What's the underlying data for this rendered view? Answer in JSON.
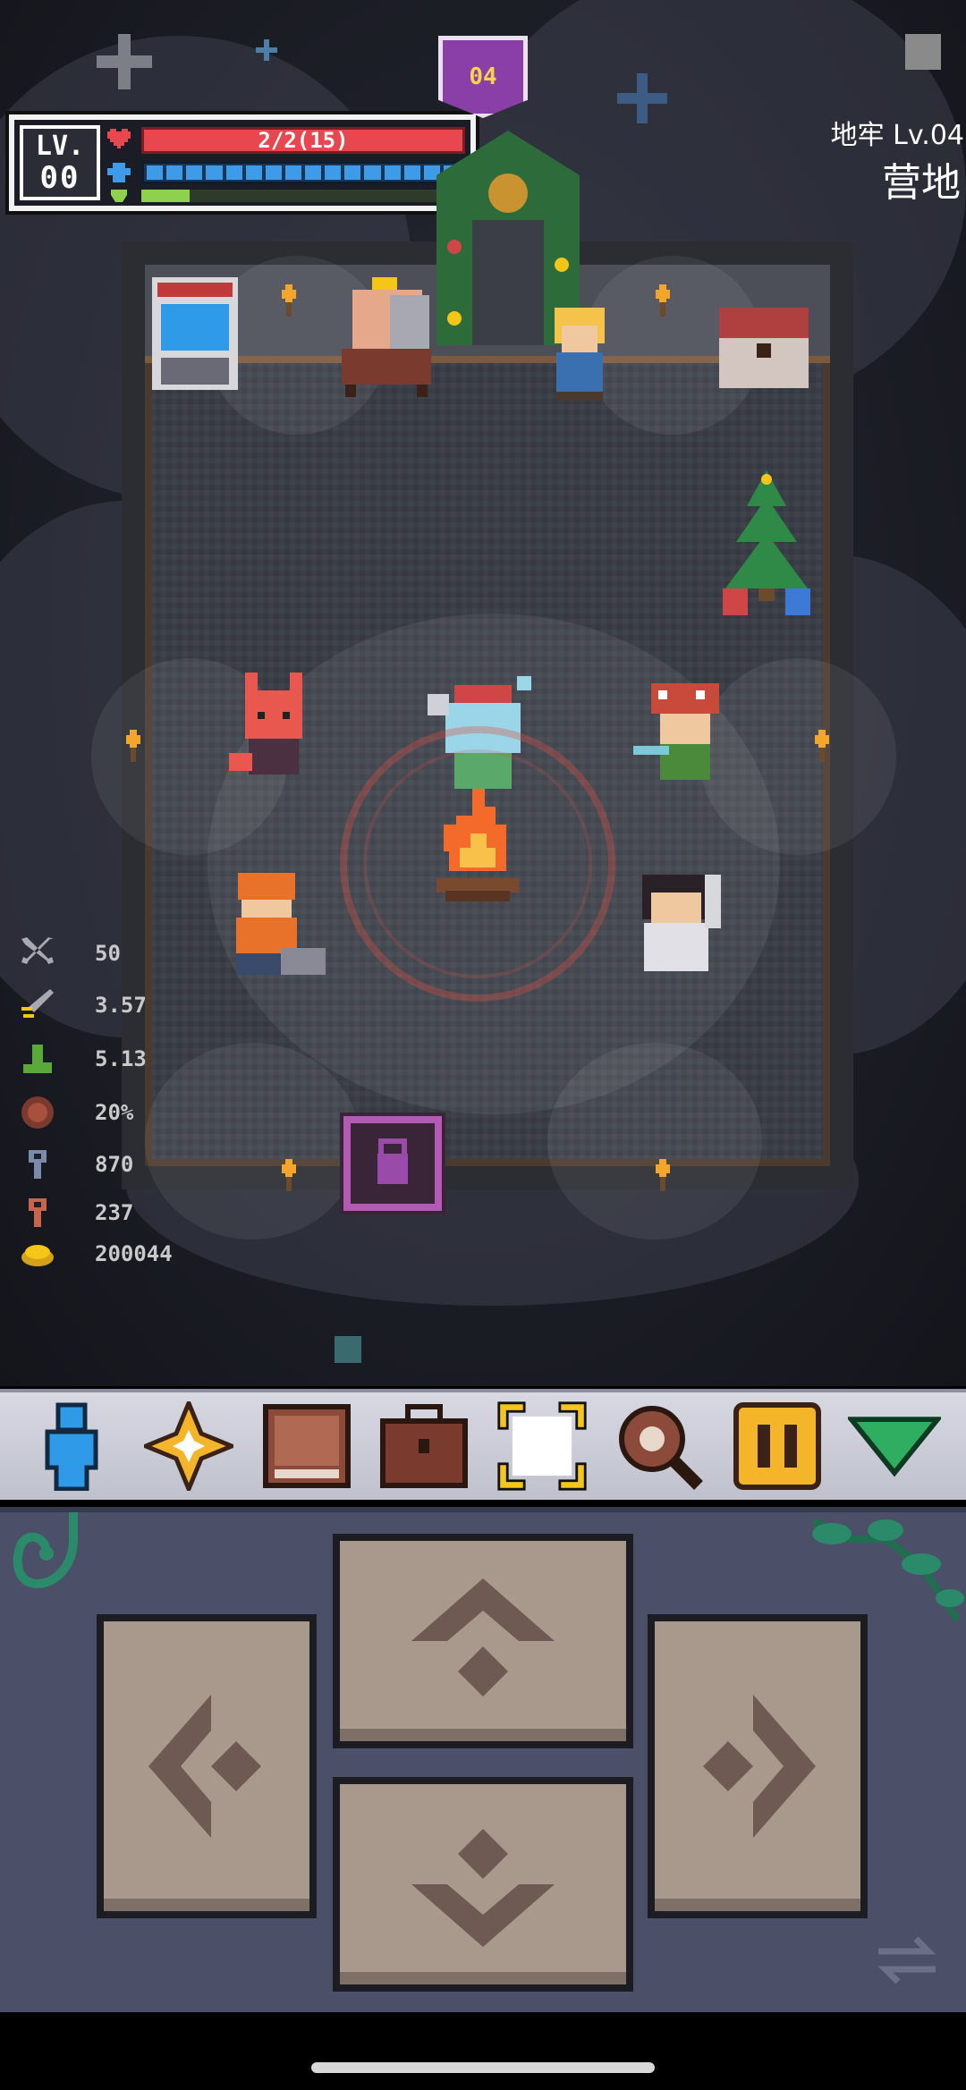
{
  "hud": {
    "level_label": "LV.",
    "level_value": "00",
    "hp_text": "2/2(15)",
    "mp_segments": 16,
    "xp_fraction": 0.15,
    "floor_badge": "04"
  },
  "location": {
    "dungeon": "地牢 Lv.04",
    "area": "营地"
  },
  "stats": [
    {
      "icon": "crossed-swords-icon",
      "value": "50"
    },
    {
      "icon": "sword-speed-icon",
      "value": "3.57"
    },
    {
      "icon": "boot-icon",
      "value": "5.13"
    },
    {
      "icon": "shield-icon",
      "value": "20%"
    },
    {
      "icon": "blue-key-icon",
      "value": "870"
    },
    {
      "icon": "red-key-icon",
      "value": "237"
    },
    {
      "icon": "gold-coin-icon",
      "value": "200044"
    }
  ],
  "toolbar": [
    {
      "name": "character-icon",
      "color": "#2f9be8"
    },
    {
      "name": "skill-star-icon",
      "color": "#f5b52a"
    },
    {
      "name": "journal-book-icon",
      "color": "#8c4a3a"
    },
    {
      "name": "backpack-icon",
      "color": "#7a3a2e"
    },
    {
      "name": "target-select-icon",
      "color": "#f5c518",
      "active": true
    },
    {
      "name": "magnifier-icon",
      "color": "#8c4a3a"
    },
    {
      "name": "pause-icon",
      "color": "#f5b52a"
    },
    {
      "name": "collapse-arrow-icon",
      "color": "#2fae62"
    }
  ],
  "colors": {
    "hp": "#e8474f",
    "mp": "#3d9be8",
    "xp": "#8fd14f",
    "control_panel": "#4b5068",
    "dpad_button": "#a8998c"
  }
}
